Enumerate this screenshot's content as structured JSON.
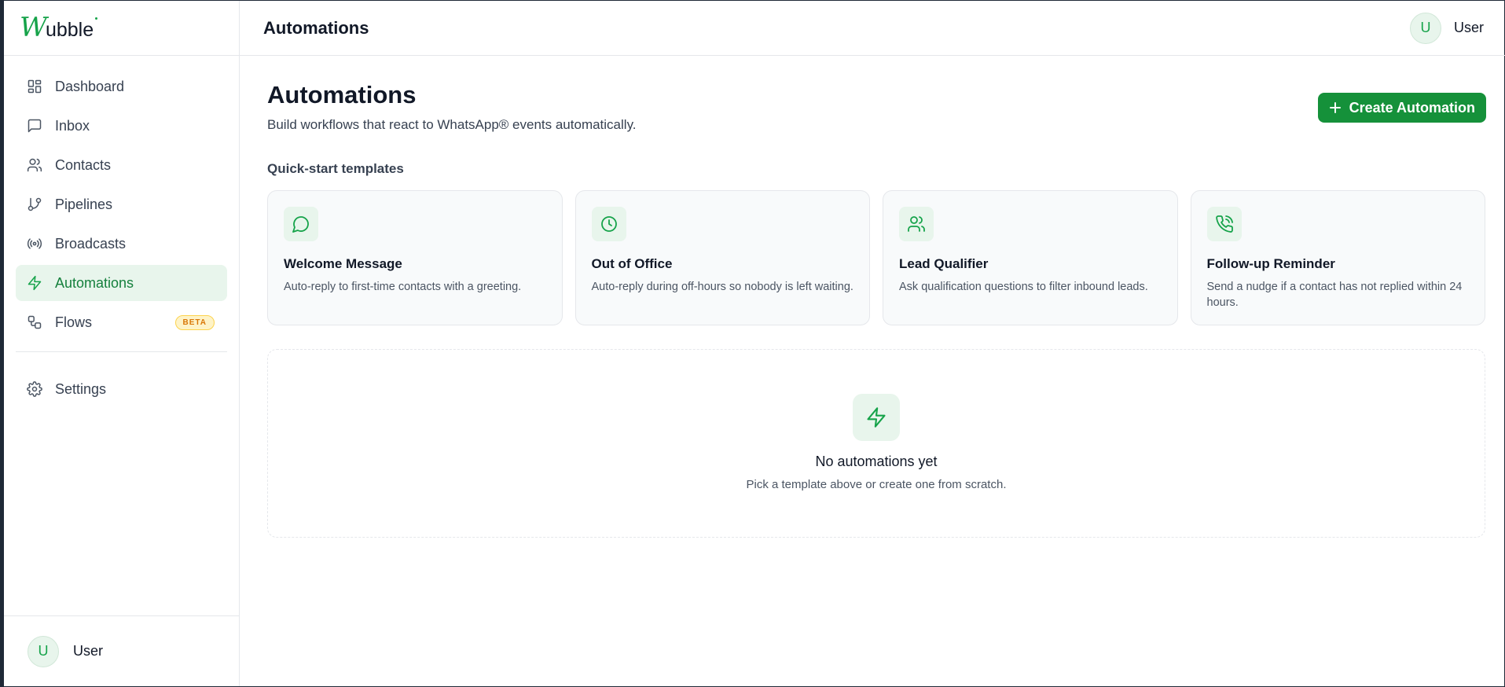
{
  "brand": {
    "logo_mark": "W",
    "logo_text": "ubble"
  },
  "sidebar": {
    "items": [
      {
        "label": "Dashboard",
        "icon": "dashboard-icon"
      },
      {
        "label": "Inbox",
        "icon": "message-square-icon"
      },
      {
        "label": "Contacts",
        "icon": "users-icon"
      },
      {
        "label": "Pipelines",
        "icon": "git-branch-icon"
      },
      {
        "label": "Broadcasts",
        "icon": "radio-icon"
      },
      {
        "label": "Automations",
        "icon": "zap-icon",
        "active": true
      },
      {
        "label": "Flows",
        "icon": "workflow-icon",
        "badge": "BETA"
      }
    ],
    "settings_label": "Settings",
    "user": {
      "initial": "U",
      "name": "User"
    }
  },
  "topbar": {
    "title": "Automations",
    "user": {
      "initial": "U",
      "name": "User"
    }
  },
  "main": {
    "title": "Automations",
    "subtitle": "Build workflows that react to WhatsApp® events automatically.",
    "create_button_label": "Create Automation",
    "templates_heading": "Quick-start templates",
    "templates": [
      {
        "title": "Welcome Message",
        "description": "Auto-reply to first-time contacts with a greeting.",
        "icon": "message-circle-icon"
      },
      {
        "title": "Out of Office",
        "description": "Auto-reply during off-hours so nobody is left waiting.",
        "icon": "clock-icon"
      },
      {
        "title": "Lead Qualifier",
        "description": "Ask qualification questions to filter inbound leads.",
        "icon": "users-icon"
      },
      {
        "title": "Follow-up Reminder",
        "description": "Send a nudge if a contact has not replied within 24 hours.",
        "icon": "phone-call-icon"
      }
    ],
    "empty_state": {
      "title": "No automations yet",
      "description": "Pick a template above or create one from scratch.",
      "icon": "zap-icon"
    }
  },
  "colors": {
    "accent": "#16a34a",
    "button": "#15913a",
    "active_bg": "#e8f5ec",
    "badge": "#d97706"
  }
}
